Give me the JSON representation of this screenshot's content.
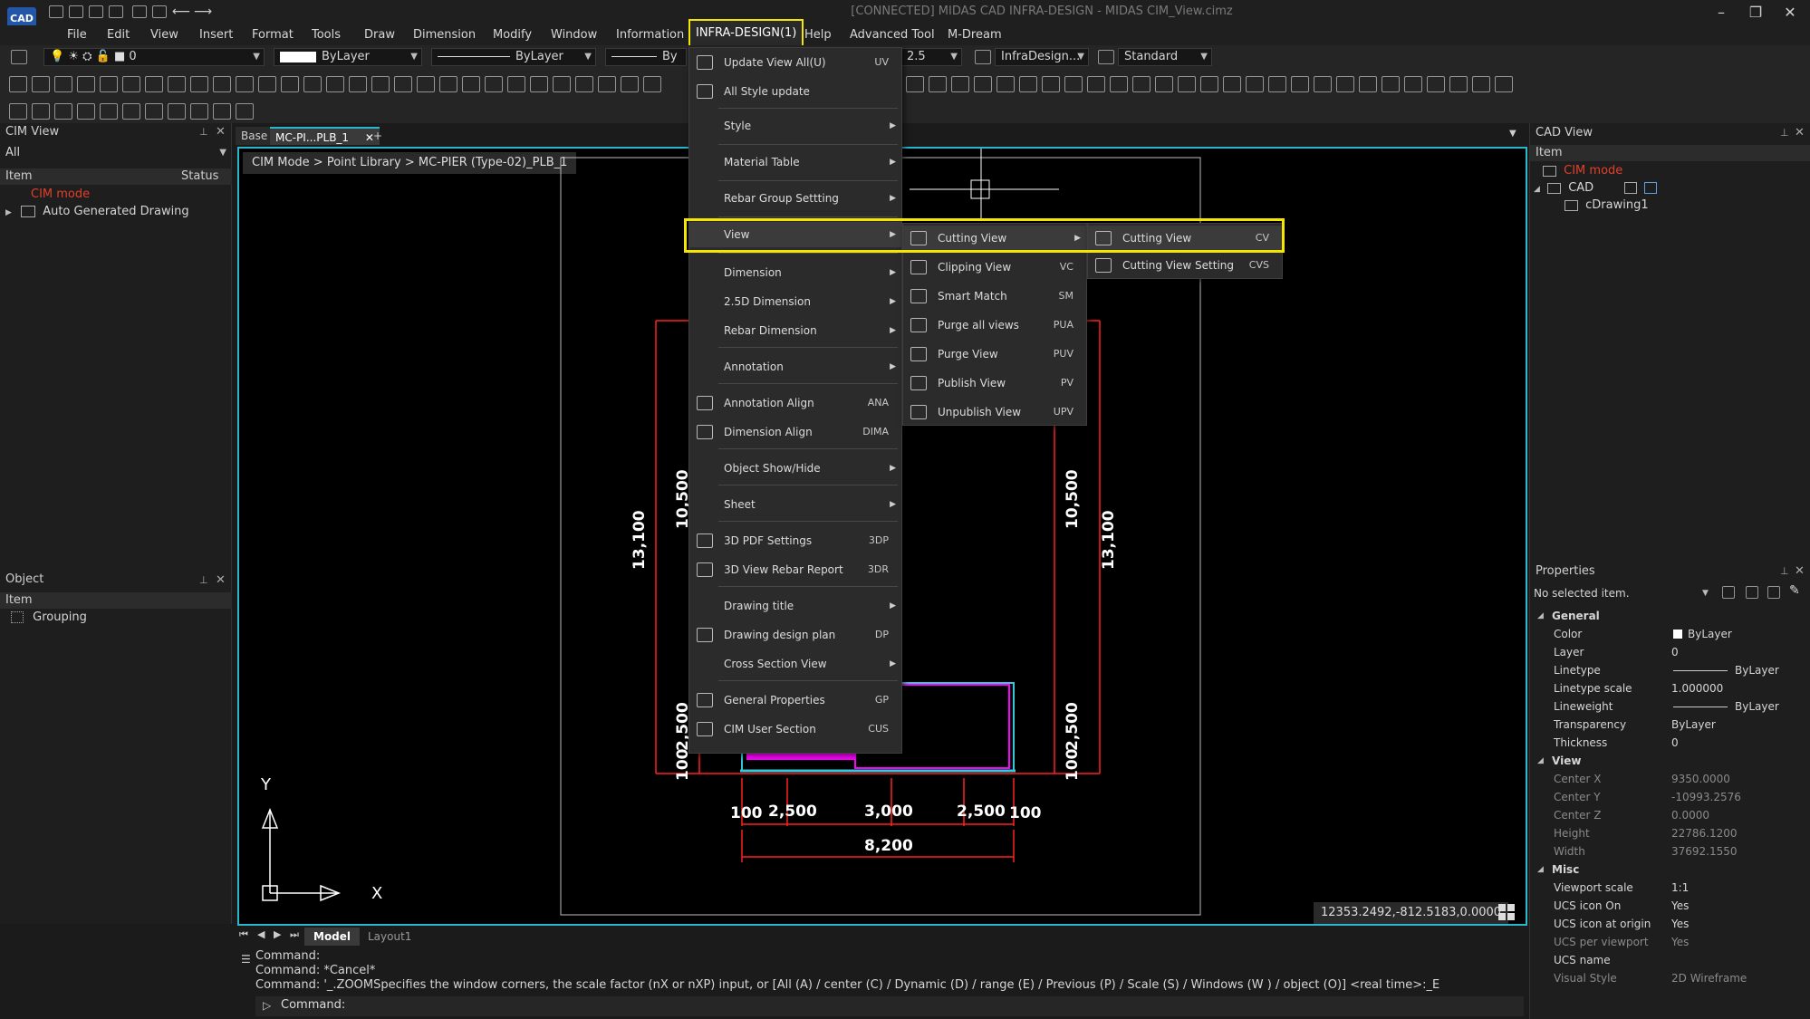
{
  "title_bar": {
    "logo": "CAD",
    "title": "[CONNECTED] MIDAS CAD INFRA-DESIGN - MIDAS CIM_View.cimz",
    "minimize": "–",
    "restore": "❐",
    "close": "✕"
  },
  "menubar": {
    "items": [
      "File",
      "Edit",
      "View",
      "Insert",
      "Format",
      "Tools",
      "Draw",
      "Dimension",
      "Modify",
      "Window",
      "Information",
      "INFRA-DESIGN(1)",
      "Help",
      "Advanced Tool",
      "M-Dream"
    ]
  },
  "toolbar": {
    "layer_value": "0",
    "color_value": "ByLayer",
    "linetype_value": "ByLayer",
    "lineweight_value": "By",
    "scale_value": "2.5",
    "dimstyle_value": "InfraDesign...",
    "textstyle_value": "Standard"
  },
  "cim_view": {
    "title": "CIM View",
    "filter": "All",
    "col_item": "Item",
    "col_status": "Status",
    "rows": [
      "CIM mode",
      "Auto Generated Drawing"
    ]
  },
  "object_panel": {
    "title": "Object",
    "col_item": "Item",
    "rows": [
      "Grouping"
    ]
  },
  "tabs": {
    "base": "Base",
    "active": "MC-PI...PLB_1",
    "add": "+"
  },
  "breadcrumb": "CIM Mode > Point Library > MC-PIER (Type-02)_PLB_1",
  "drawing": {
    "dims_left": [
      "10,500",
      "13,100",
      "2,500",
      "100"
    ],
    "dims_right": [
      "10,500",
      "13,100",
      "2,500",
      "100"
    ],
    "dims_bottom": [
      "100",
      "2,500",
      "3,000",
      "2,500",
      "100"
    ],
    "dim_total": "8,200",
    "axis_x": "X",
    "axis_y": "Y",
    "coords": "12353.2492,-812.5183,0.0000"
  },
  "infra_menu": {
    "items": [
      {
        "label": "Update View All(U)",
        "shortcut": "UV",
        "icon": "update-view-icon"
      },
      {
        "label": "All Style update",
        "shortcut": "",
        "icon": "style-update-icon"
      },
      {
        "label": "Style",
        "shortcut": "",
        "sub": true
      },
      {
        "label": "Material Table",
        "shortcut": "",
        "sub": true
      },
      {
        "label": "Rebar Group Settting",
        "shortcut": "",
        "sub": true
      },
      {
        "label": "View",
        "shortcut": "",
        "sub": true
      },
      {
        "label": "Dimension",
        "shortcut": "",
        "sub": true
      },
      {
        "label": "2.5D Dimension",
        "shortcut": "",
        "sub": true
      },
      {
        "label": "Rebar Dimension",
        "shortcut": "",
        "sub": true
      },
      {
        "label": "Annotation",
        "shortcut": "",
        "sub": true
      },
      {
        "label": "Annotation Align",
        "shortcut": "ANA",
        "icon": "annotation-align-icon"
      },
      {
        "label": "Dimension Align",
        "shortcut": "DIMA",
        "icon": "dimension-align-icon"
      },
      {
        "label": "Object Show/Hide",
        "shortcut": "",
        "sub": true
      },
      {
        "label": "Sheet",
        "shortcut": "",
        "sub": true
      },
      {
        "label": "3D PDF Settings",
        "shortcut": "3DP",
        "icon": "pdf-settings-icon"
      },
      {
        "label": "3D View Rebar Report",
        "shortcut": "3DR",
        "icon": "rebar-report-icon"
      },
      {
        "label": "Drawing title",
        "shortcut": "",
        "sub": true
      },
      {
        "label": "Drawing design plan",
        "shortcut": "DP",
        "icon": "design-plan-icon"
      },
      {
        "label": "Cross Section View",
        "shortcut": "",
        "sub": true
      },
      {
        "label": "General Properties",
        "shortcut": "GP",
        "icon": "gear-icon"
      },
      {
        "label": "CIM User Section",
        "shortcut": "CUS",
        "icon": "user-section-icon"
      }
    ]
  },
  "view_submenu": {
    "items": [
      {
        "label": "Cutting View",
        "shortcut": "",
        "sub": true
      },
      {
        "label": "Clipping View",
        "shortcut": "VC"
      },
      {
        "label": "Smart Match",
        "shortcut": "SM"
      },
      {
        "label": "Purge all views",
        "shortcut": "PUA"
      },
      {
        "label": "Purge View",
        "shortcut": "PUV"
      },
      {
        "label": "Publish View",
        "shortcut": "PV"
      },
      {
        "label": "Unpublish View",
        "shortcut": "UPV"
      }
    ]
  },
  "cutting_submenu": {
    "items": [
      {
        "label": "Cutting View",
        "shortcut": "CV"
      },
      {
        "label": "Cutting View Setting",
        "shortcut": "CVS"
      }
    ]
  },
  "cad_view": {
    "title": "CAD View",
    "col_item": "Item",
    "rows": [
      "CIM mode",
      "CAD",
      "cDrawing1"
    ]
  },
  "properties": {
    "title": "Properties",
    "selection": "No selected item.",
    "general_label": "General",
    "general": [
      {
        "k": "Color",
        "v": "ByLayer"
      },
      {
        "k": "Layer",
        "v": "0"
      },
      {
        "k": "Linetype",
        "v": "ByLayer"
      },
      {
        "k": "Linetype scale",
        "v": "1.000000"
      },
      {
        "k": "Lineweight",
        "v": "ByLayer"
      },
      {
        "k": "Transparency",
        "v": "ByLayer"
      },
      {
        "k": "Thickness",
        "v": "0"
      }
    ],
    "view_label": "View",
    "view": [
      {
        "k": "Center X",
        "v": "9350.0000"
      },
      {
        "k": "Center Y",
        "v": "-10993.2576"
      },
      {
        "k": "Center Z",
        "v": "0.0000"
      },
      {
        "k": "Height",
        "v": "22786.1200"
      },
      {
        "k": "Width",
        "v": "37692.1550"
      }
    ],
    "misc_label": "Misc",
    "misc": [
      {
        "k": "Viewport scale",
        "v": "1:1"
      },
      {
        "k": "UCS icon On",
        "v": "Yes"
      },
      {
        "k": "UCS icon at origin",
        "v": "Yes"
      },
      {
        "k": "UCS per viewport",
        "v": "Yes"
      },
      {
        "k": "UCS name",
        "v": ""
      },
      {
        "k": "Visual Style",
        "v": "2D Wireframe"
      }
    ]
  },
  "layout_tabs": {
    "model": "Model",
    "layout1": "Layout1"
  },
  "command": {
    "lines": [
      "Command:",
      "Command:  *Cancel*",
      "Command:  '_.ZOOMSpecifies the window corners, the scale factor (nX or nXP) input, or [All (A) / center (C) / Dynamic (D) / range (E) / Previous (P) / Scale (S) / Windows (W ) / object (O)] <real time>:_E"
    ],
    "prompt": "Command:"
  },
  "colors": {
    "accent_highlight": "#f4e600",
    "viewport_border": "#2ab7c9",
    "pier_fill": "#ff00ff",
    "dimension_line": "#ff2020"
  }
}
